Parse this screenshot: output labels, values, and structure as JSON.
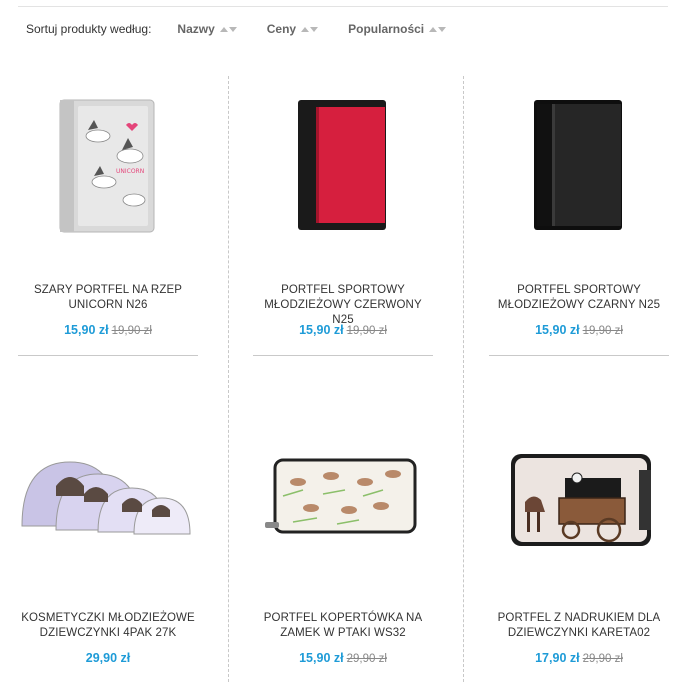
{
  "sort": {
    "label": "Sortuj produkty według:",
    "options": [
      {
        "label": "Nazwy"
      },
      {
        "label": "Ceny"
      },
      {
        "label": "Popularności"
      }
    ]
  },
  "products": [
    {
      "line1": "SZARY PORTFEL NA RZEP",
      "line2": "UNICORN N26",
      "price": "15,90 zł",
      "old_price": "19,90 zł",
      "image": "gray-unicorn-wallet"
    },
    {
      "line1": "PORTFEL SPORTOWY",
      "line2": "MŁODZIEŻOWY CZERWONY N25",
      "price": "15,90 zł",
      "old_price": "19,90 zł",
      "image": "red-sport-wallet"
    },
    {
      "line1": "PORTFEL SPORTOWY",
      "line2": "MŁODZIEŻOWY CZARNY N25",
      "price": "15,90 zł",
      "old_price": "19,90 zł",
      "image": "black-sport-wallet"
    },
    {
      "line1": "KOSMETYCZKI MŁODZIEŻOWE",
      "line2": "DZIEWCZYNKI 4PAK 27K",
      "price": "29,90 zł",
      "old_price": "",
      "image": "cosmetic-bags-4pack"
    },
    {
      "line1": "PORTFEL KOPERTÓWKA NA",
      "line2": "ZAMEK W PTAKI WS32",
      "price": "15,90 zł",
      "old_price": "29,90 zł",
      "image": "bird-print-wallet"
    },
    {
      "line1": "PORTFEL Z NADRUKIEM DLA",
      "line2": "DZIEWCZYNKI KARETA02",
      "price": "17,90 zł",
      "old_price": "29,90 zł",
      "image": "carriage-print-wallet"
    }
  ],
  "colors": {
    "price": "#1e9bd7",
    "old_price": "#888888"
  }
}
